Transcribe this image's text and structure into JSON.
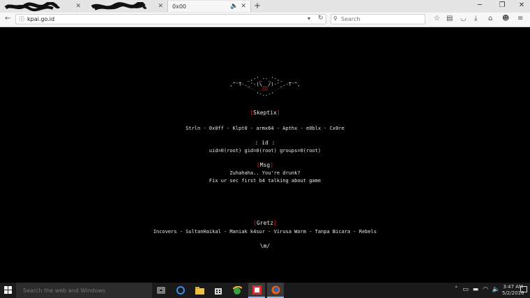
{
  "tabs": [
    {
      "title": "",
      "redacted": true
    },
    {
      "title": "",
      "redacted": true
    },
    {
      "title": "0x00",
      "active": true
    }
  ],
  "navbar": {
    "url": "kpai.go.id",
    "search_placeholder": "Search"
  },
  "page": {
    "ascii_art": [
      "  _,-'_--_'-,_  ",
      ",^'T-._'-(\\__/)-'_.-T'^,",
      "'-.  oo  .-'",
      "'-..-'"
    ],
    "team_prefix": "[",
    "team_name": "Skeptix",
    "team_suffix": "]",
    "members": "Strln - 0x0ff - Klpt0 - armx64 - Apthx - e0blx - Cx0re",
    "id_label": ": id :",
    "id_output": "uid=0(root) gid=0(root) groups=0(root)",
    "msg_label": "Msg",
    "msg_line1": "Zuhahaha.. You're drunk?",
    "msg_line2": "Fix ur sec first b4 talking about game",
    "gretz_label": "Gretz",
    "gretz_list": "Incovers - SultanHaikal - Maniak k4sur - Virusa Worm - Tanpa Bicara - Rebels",
    "sign_off": "\\m/"
  },
  "taskbar": {
    "search_placeholder": "Search the web and Windows",
    "time": "3:47 AM",
    "date": "5/2/2016"
  },
  "colors": {
    "accent_red": "#d02020",
    "page_bg": "#000000"
  }
}
